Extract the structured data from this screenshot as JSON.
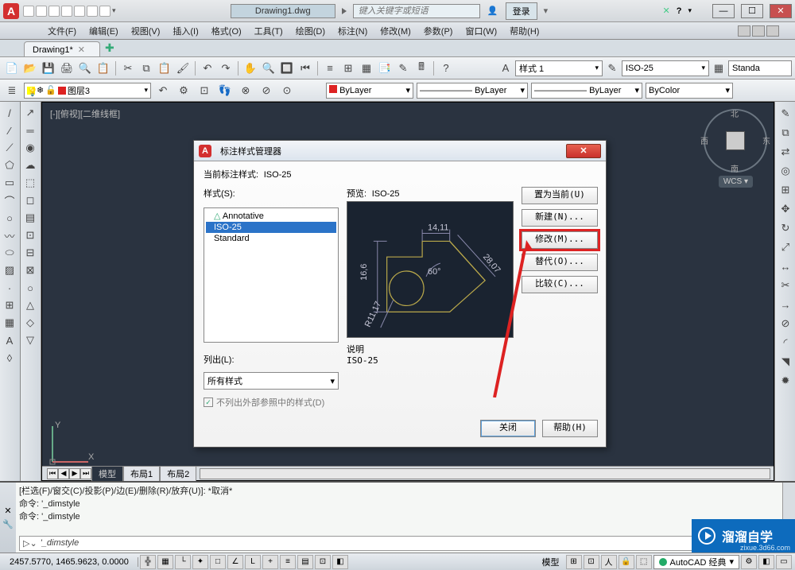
{
  "title": {
    "doc": "Drawing1.dwg",
    "search_placeholder": "键入关键字或短语",
    "login": "登录"
  },
  "menu": [
    "文件(F)",
    "编辑(E)",
    "视图(V)",
    "插入(I)",
    "格式(O)",
    "工具(T)",
    "绘图(D)",
    "标注(N)",
    "修改(M)",
    "参数(P)",
    "窗口(W)",
    "帮助(H)"
  ],
  "doc_tab": "Drawing1*",
  "style_combos": {
    "dim_style": "样式 1",
    "std": "ISO-25",
    "tbl": "Standa"
  },
  "layer": {
    "current": "图层3",
    "bylayer": "ByLayer",
    "bycolor": "ByColor"
  },
  "view_label": "[-][俯视][二维线框]",
  "compass": {
    "n": "北",
    "s": "南",
    "w": "西",
    "e": "东"
  },
  "wcs": "WCS ▾",
  "model_tabs": {
    "model": "模型",
    "layout1": "布局1",
    "layout2": "布局2"
  },
  "cmd": {
    "hist1": "[栏选(F)/窗交(C)/投影(P)/边(E)/删除(R)/放弃(U)]: *取消*",
    "hist2": "命令: '_dimstyle",
    "hist3": "命令: '_dimstyle",
    "input": "'_dimstyle"
  },
  "status": {
    "coord": "2457.5770, 1465.9623, 0.0000",
    "model": "模型",
    "workspace": "AutoCAD 经典"
  },
  "dialog": {
    "title": "标注样式管理器",
    "current_label": "当前标注样式:",
    "current_value": "ISO-25",
    "styles_label": "样式(S):",
    "styles": [
      "Annotative",
      "ISO-25",
      "Standard"
    ],
    "preview_label": "预览:",
    "preview_value": "ISO-25",
    "buttons": {
      "set": "置为当前(U)",
      "new": "新建(N)...",
      "mod": "修改(M)...",
      "over": "替代(O)...",
      "comp": "比较(C)..."
    },
    "listout_label": "列出(L):",
    "listout_value": "所有样式",
    "chk_text": "不列出外部参照中的样式(D)",
    "desc_label": "说明",
    "desc_value": "ISO-25",
    "close": "关闭",
    "help": "帮助(H)"
  },
  "preview_dims": {
    "top": "14,11",
    "left": "16,6",
    "right": "28,07",
    "angle": "60°",
    "radius": "R11,17"
  },
  "watermark": {
    "text": "溜溜自学",
    "url": "zixue.3d66.com"
  }
}
